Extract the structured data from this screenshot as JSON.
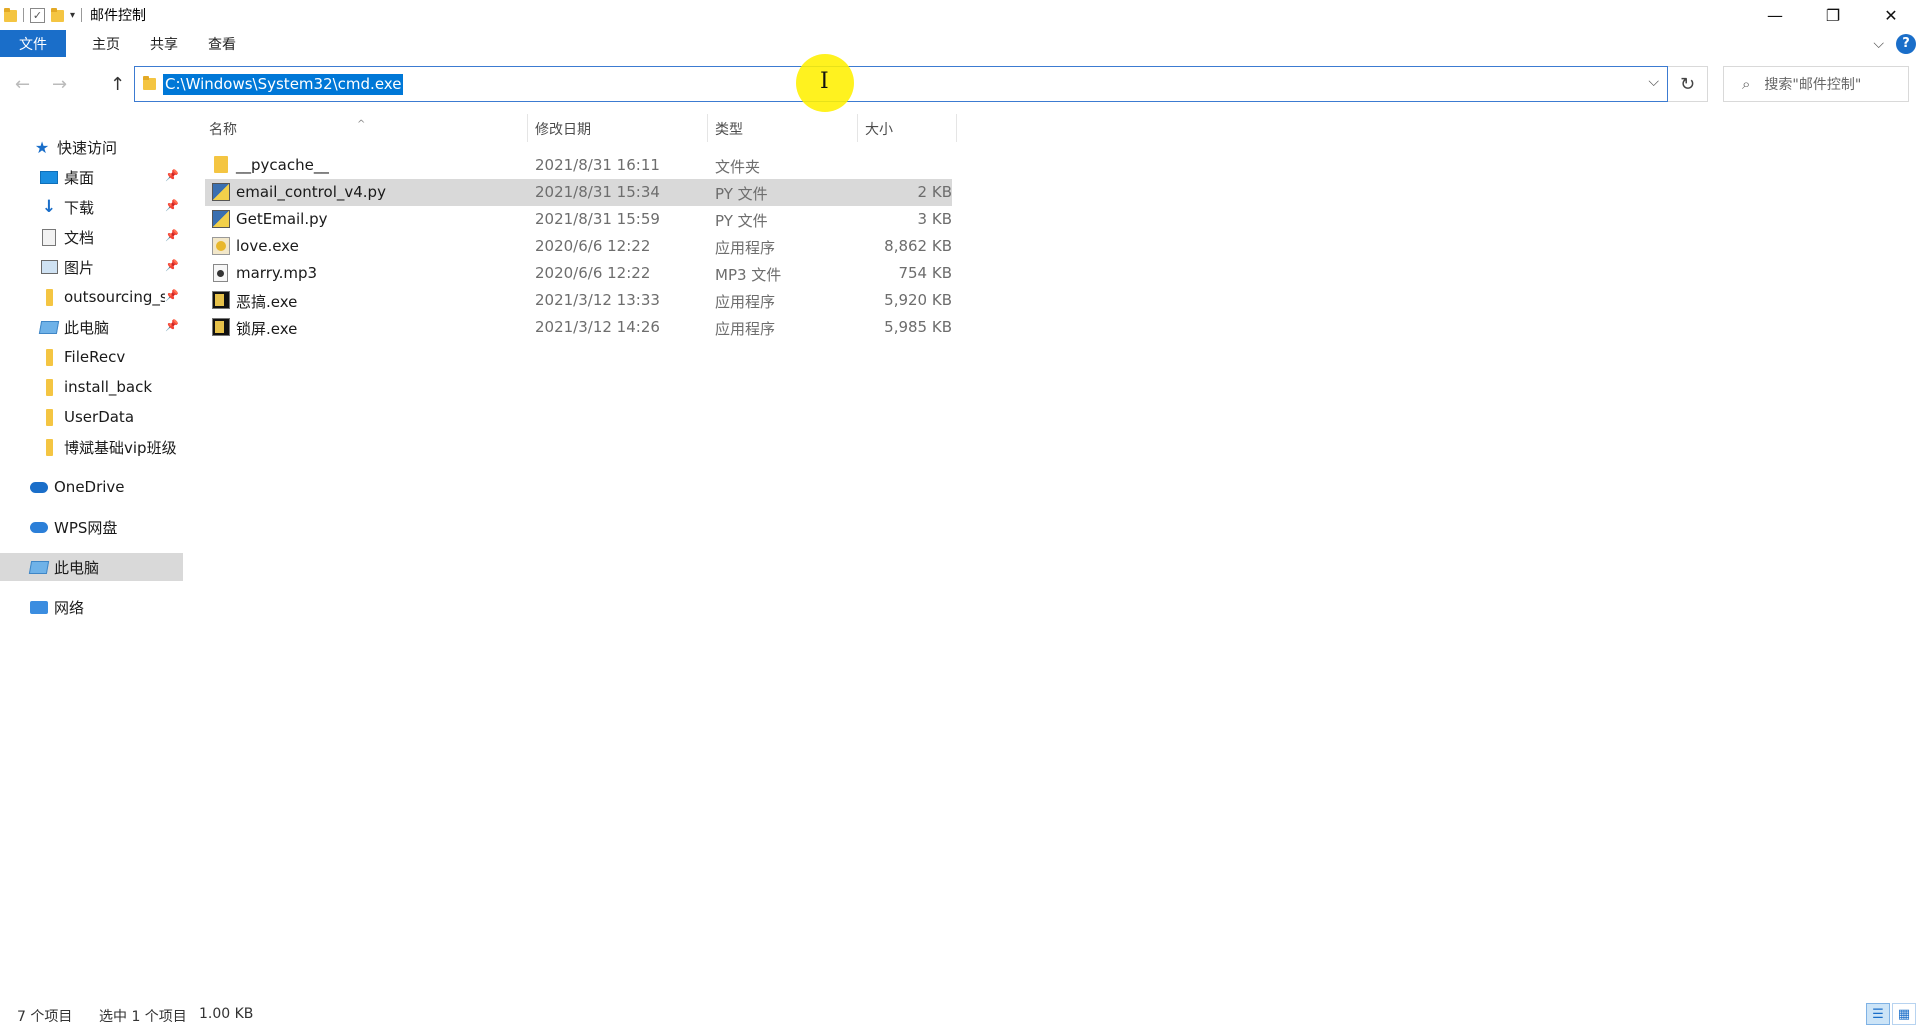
{
  "window": {
    "title": "邮件控制",
    "controls": {
      "minimize": "—",
      "maximize": "❐",
      "close": "✕"
    }
  },
  "ribbon": {
    "tabs": [
      "文件",
      "主页",
      "共享",
      "查看"
    ],
    "collapse_glyph": "⌵",
    "help_glyph": "?"
  },
  "address_bar": {
    "path": "C:\\Windows\\System32\\cmd.exe",
    "back_glyph": "←",
    "forward_glyph": "→",
    "up_glyph": "↑",
    "dropdown_glyph": "⌵",
    "refresh_glyph": "↻",
    "search_placeholder": "搜索\"邮件控制\""
  },
  "sidebar": {
    "quick_access": "快速访问",
    "items": [
      {
        "label": "桌面",
        "icon": "desktop-icon",
        "pinned": true
      },
      {
        "label": "下载",
        "icon": "download-icon",
        "pinned": true
      },
      {
        "label": "文档",
        "icon": "document-icon",
        "pinned": true
      },
      {
        "label": "图片",
        "icon": "picture-icon",
        "pinned": true
      },
      {
        "label": "outsourcing_s",
        "icon": "folder-icon",
        "pinned": true
      },
      {
        "label": "此电脑",
        "icon": "computer-icon",
        "pinned": true
      },
      {
        "label": "FileRecv",
        "icon": "folder-icon",
        "pinned": false
      },
      {
        "label": "install_back",
        "icon": "folder-icon",
        "pinned": false
      },
      {
        "label": "UserData",
        "icon": "folder-icon",
        "pinned": false
      },
      {
        "label": "博斌基础vip班级",
        "icon": "folder-icon",
        "pinned": false
      }
    ],
    "onedrive": "OneDrive",
    "wps": "WPS网盘",
    "this_pc": "此电脑",
    "network": "网络",
    "pin_glyph": "📌"
  },
  "columns": {
    "name": "名称",
    "date": "修改日期",
    "type": "类型",
    "size": "大小",
    "sort_glyph": "^"
  },
  "files": [
    {
      "name": "__pycache__",
      "date": "2021/8/31 16:11",
      "type": "文件夹",
      "size": "",
      "icon": "folder-icon"
    },
    {
      "name": "email_control_v4.py",
      "date": "2021/8/31 15:34",
      "type": "PY 文件",
      "size": "2 KB",
      "icon": "python-file-icon"
    },
    {
      "name": "GetEmail.py",
      "date": "2021/8/31 15:59",
      "type": "PY 文件",
      "size": "3 KB",
      "icon": "python-file-icon"
    },
    {
      "name": "love.exe",
      "date": "2020/6/6 12:22",
      "type": "应用程序",
      "size": "8,862 KB",
      "icon": "exe-icon"
    },
    {
      "name": "marry.mp3",
      "date": "2020/6/6 12:22",
      "type": "MP3 文件",
      "size": "754 KB",
      "icon": "audio-file-icon"
    },
    {
      "name": "恶搞.exe",
      "date": "2021/3/12 13:33",
      "type": "应用程序",
      "size": "5,920 KB",
      "icon": "exe-icon"
    },
    {
      "name": "锁屏.exe",
      "date": "2021/3/12 14:26",
      "type": "应用程序",
      "size": "5,985 KB",
      "icon": "exe-icon"
    }
  ],
  "status": {
    "count": "7 个项目",
    "selected": "选中 1 个项目",
    "size": "1.00 KB"
  },
  "colors": {
    "accent": "#1a6ec9",
    "selection": "#0078d7",
    "row_selected": "#d9d9d9",
    "cursor_highlight": "#fff000"
  }
}
